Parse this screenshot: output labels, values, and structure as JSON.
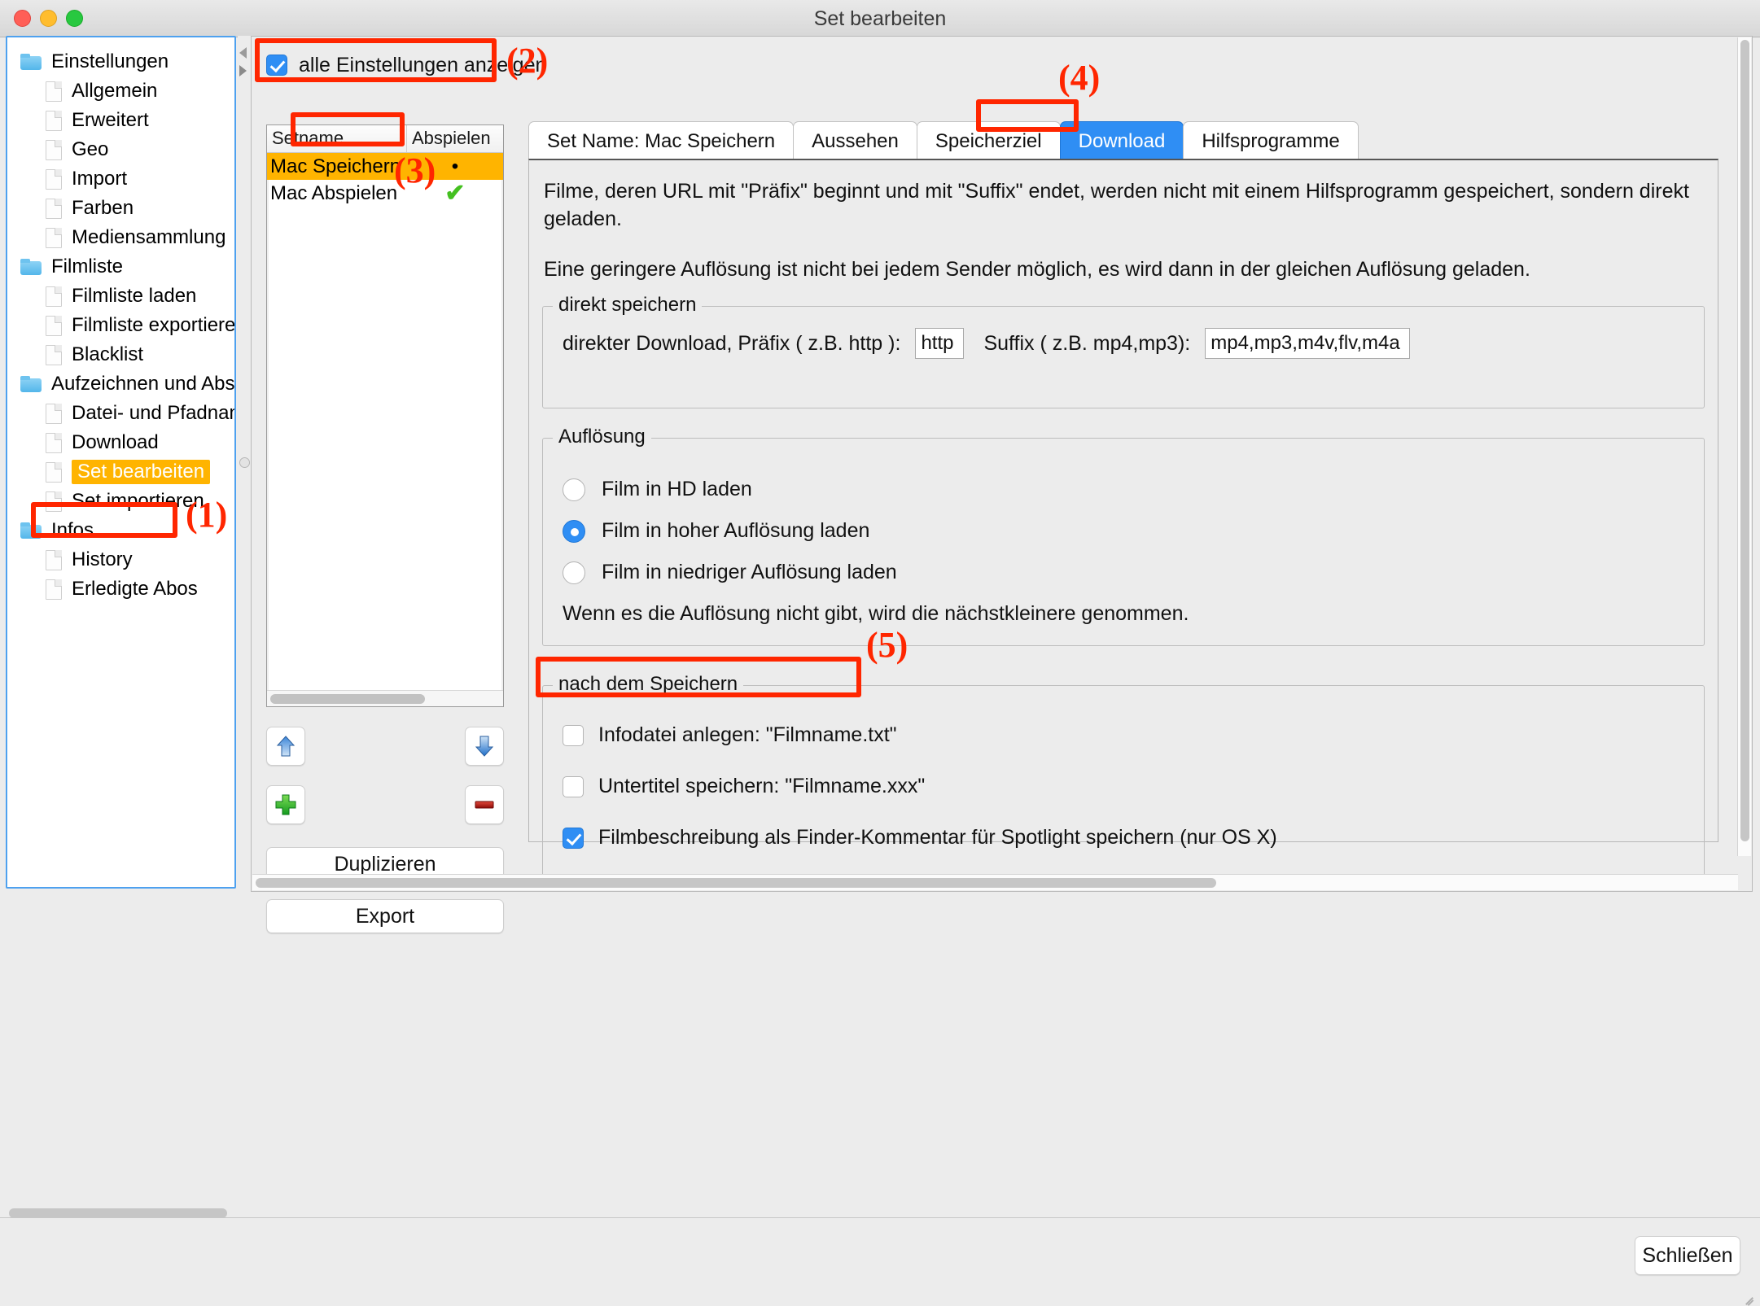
{
  "window": {
    "title": "Set bearbeiten",
    "traffic_lights": [
      "close",
      "minimize",
      "zoom"
    ]
  },
  "sidebar": {
    "items": [
      {
        "label": "Einstellungen",
        "type": "folder",
        "level": 0,
        "selected": false
      },
      {
        "label": "Allgemein",
        "type": "file",
        "level": 1,
        "selected": false
      },
      {
        "label": "Erweitert",
        "type": "file",
        "level": 1,
        "selected": false
      },
      {
        "label": "Geo",
        "type": "file",
        "level": 1,
        "selected": false
      },
      {
        "label": "Import",
        "type": "file",
        "level": 1,
        "selected": false
      },
      {
        "label": "Farben",
        "type": "file",
        "level": 1,
        "selected": false
      },
      {
        "label": "Mediensammlung",
        "type": "file",
        "level": 1,
        "selected": false
      },
      {
        "label": "Filmliste",
        "type": "folder",
        "level": 0,
        "selected": false
      },
      {
        "label": "Filmliste laden",
        "type": "file",
        "level": 1,
        "selected": false
      },
      {
        "label": "Filmliste exportieren",
        "type": "file",
        "level": 1,
        "selected": false
      },
      {
        "label": "Blacklist",
        "type": "file",
        "level": 1,
        "selected": false
      },
      {
        "label": "Aufzeichnen und Abspielen",
        "type": "folder",
        "level": 0,
        "selected": false
      },
      {
        "label": "Datei- und Pfadnamen",
        "type": "file",
        "level": 1,
        "selected": false
      },
      {
        "label": "Download",
        "type": "file",
        "level": 1,
        "selected": false
      },
      {
        "label": "Set bearbeiten",
        "type": "file",
        "level": 1,
        "selected": true
      },
      {
        "label": "Set importieren",
        "type": "file",
        "level": 1,
        "selected": false
      },
      {
        "label": "Infos",
        "type": "folder",
        "level": 0,
        "selected": false
      },
      {
        "label": "History",
        "type": "file",
        "level": 1,
        "selected": false
      },
      {
        "label": "Erledigte Abos",
        "type": "file",
        "level": 1,
        "selected": false
      }
    ]
  },
  "right_panel": {
    "show_all_checkbox": {
      "label": "alle Einstellungen anzeigen",
      "checked": true
    },
    "set_table": {
      "columns": [
        "Setname",
        "Abspielen"
      ],
      "rows": [
        {
          "name": "Mac Speichern",
          "abspielen": "•",
          "selected": true
        },
        {
          "name": "Mac Abspielen",
          "abspielen": "✔",
          "selected": false
        }
      ]
    },
    "list_buttons": {
      "move_up": "up-arrow-icon",
      "move_down": "down-arrow-icon",
      "add": "plus-icon",
      "remove": "minus-icon",
      "duplicate": "Duplizieren",
      "export": "Export"
    },
    "tabs": [
      {
        "label": "Set Name: Mac Speichern",
        "active": false
      },
      {
        "label": "Aussehen",
        "active": false
      },
      {
        "label": "Speicherziel",
        "active": false
      },
      {
        "label": "Download",
        "active": true
      },
      {
        "label": "Hilfsprogramme",
        "active": false
      }
    ],
    "download_tab": {
      "paragraph1": "Filme, deren URL mit \"Präfix\" beginnt und mit \"Suffix\" endet, werden nicht mit einem Hilfsprogramm gespeichert, sondern direkt geladen.",
      "paragraph2": "Eine geringere Auflösung ist nicht bei jedem Sender möglich, es wird dann in der gleichen Auflösung geladen.",
      "direct_save": {
        "legend": "direkt speichern",
        "prefix_label": "direkter Download, Präfix ( z.B. http ):",
        "prefix_value": "http",
        "suffix_label": "Suffix ( z.B. mp4,mp3):",
        "suffix_value": "mp4,mp3,m4v,flv,m4a"
      },
      "resolution": {
        "legend": "Auflösung",
        "options": [
          {
            "label": "Film in HD laden",
            "selected": false
          },
          {
            "label": "Film in hoher Auflösung laden",
            "selected": true
          },
          {
            "label": "Film in niedriger Auflösung laden",
            "selected": false
          }
        ],
        "hint": "Wenn es die Auflösung nicht gibt, wird die nächstkleinere genommen."
      },
      "after_save": {
        "legend": "nach dem Speichern",
        "options": [
          {
            "label": "Infodatei anlegen: \"Filmname.txt\"",
            "checked": false
          },
          {
            "label": "Untertitel speichern: \"Filmname.xxx\"",
            "checked": false
          },
          {
            "label": "Filmbeschreibung als Finder-Kommentar für Spotlight speichern (nur OS X)",
            "checked": true
          }
        ]
      }
    }
  },
  "footer": {
    "close_button": "Schließen"
  },
  "annotations": [
    {
      "id": "1",
      "target": "sidebar-item-set-bearbeiten"
    },
    {
      "id": "2",
      "target": "show-all-settings-checkbox"
    },
    {
      "id": "3",
      "target": "set-table-row-mac-speichern"
    },
    {
      "id": "4",
      "target": "tab-download"
    },
    {
      "id": "5",
      "target": "save-subtitles-checkbox"
    }
  ],
  "colors": {
    "accent_blue": "#2f8ef4",
    "selection_orange": "#FFB400",
    "annotation_red": "#ff2600",
    "window_bg": "#ececec"
  }
}
